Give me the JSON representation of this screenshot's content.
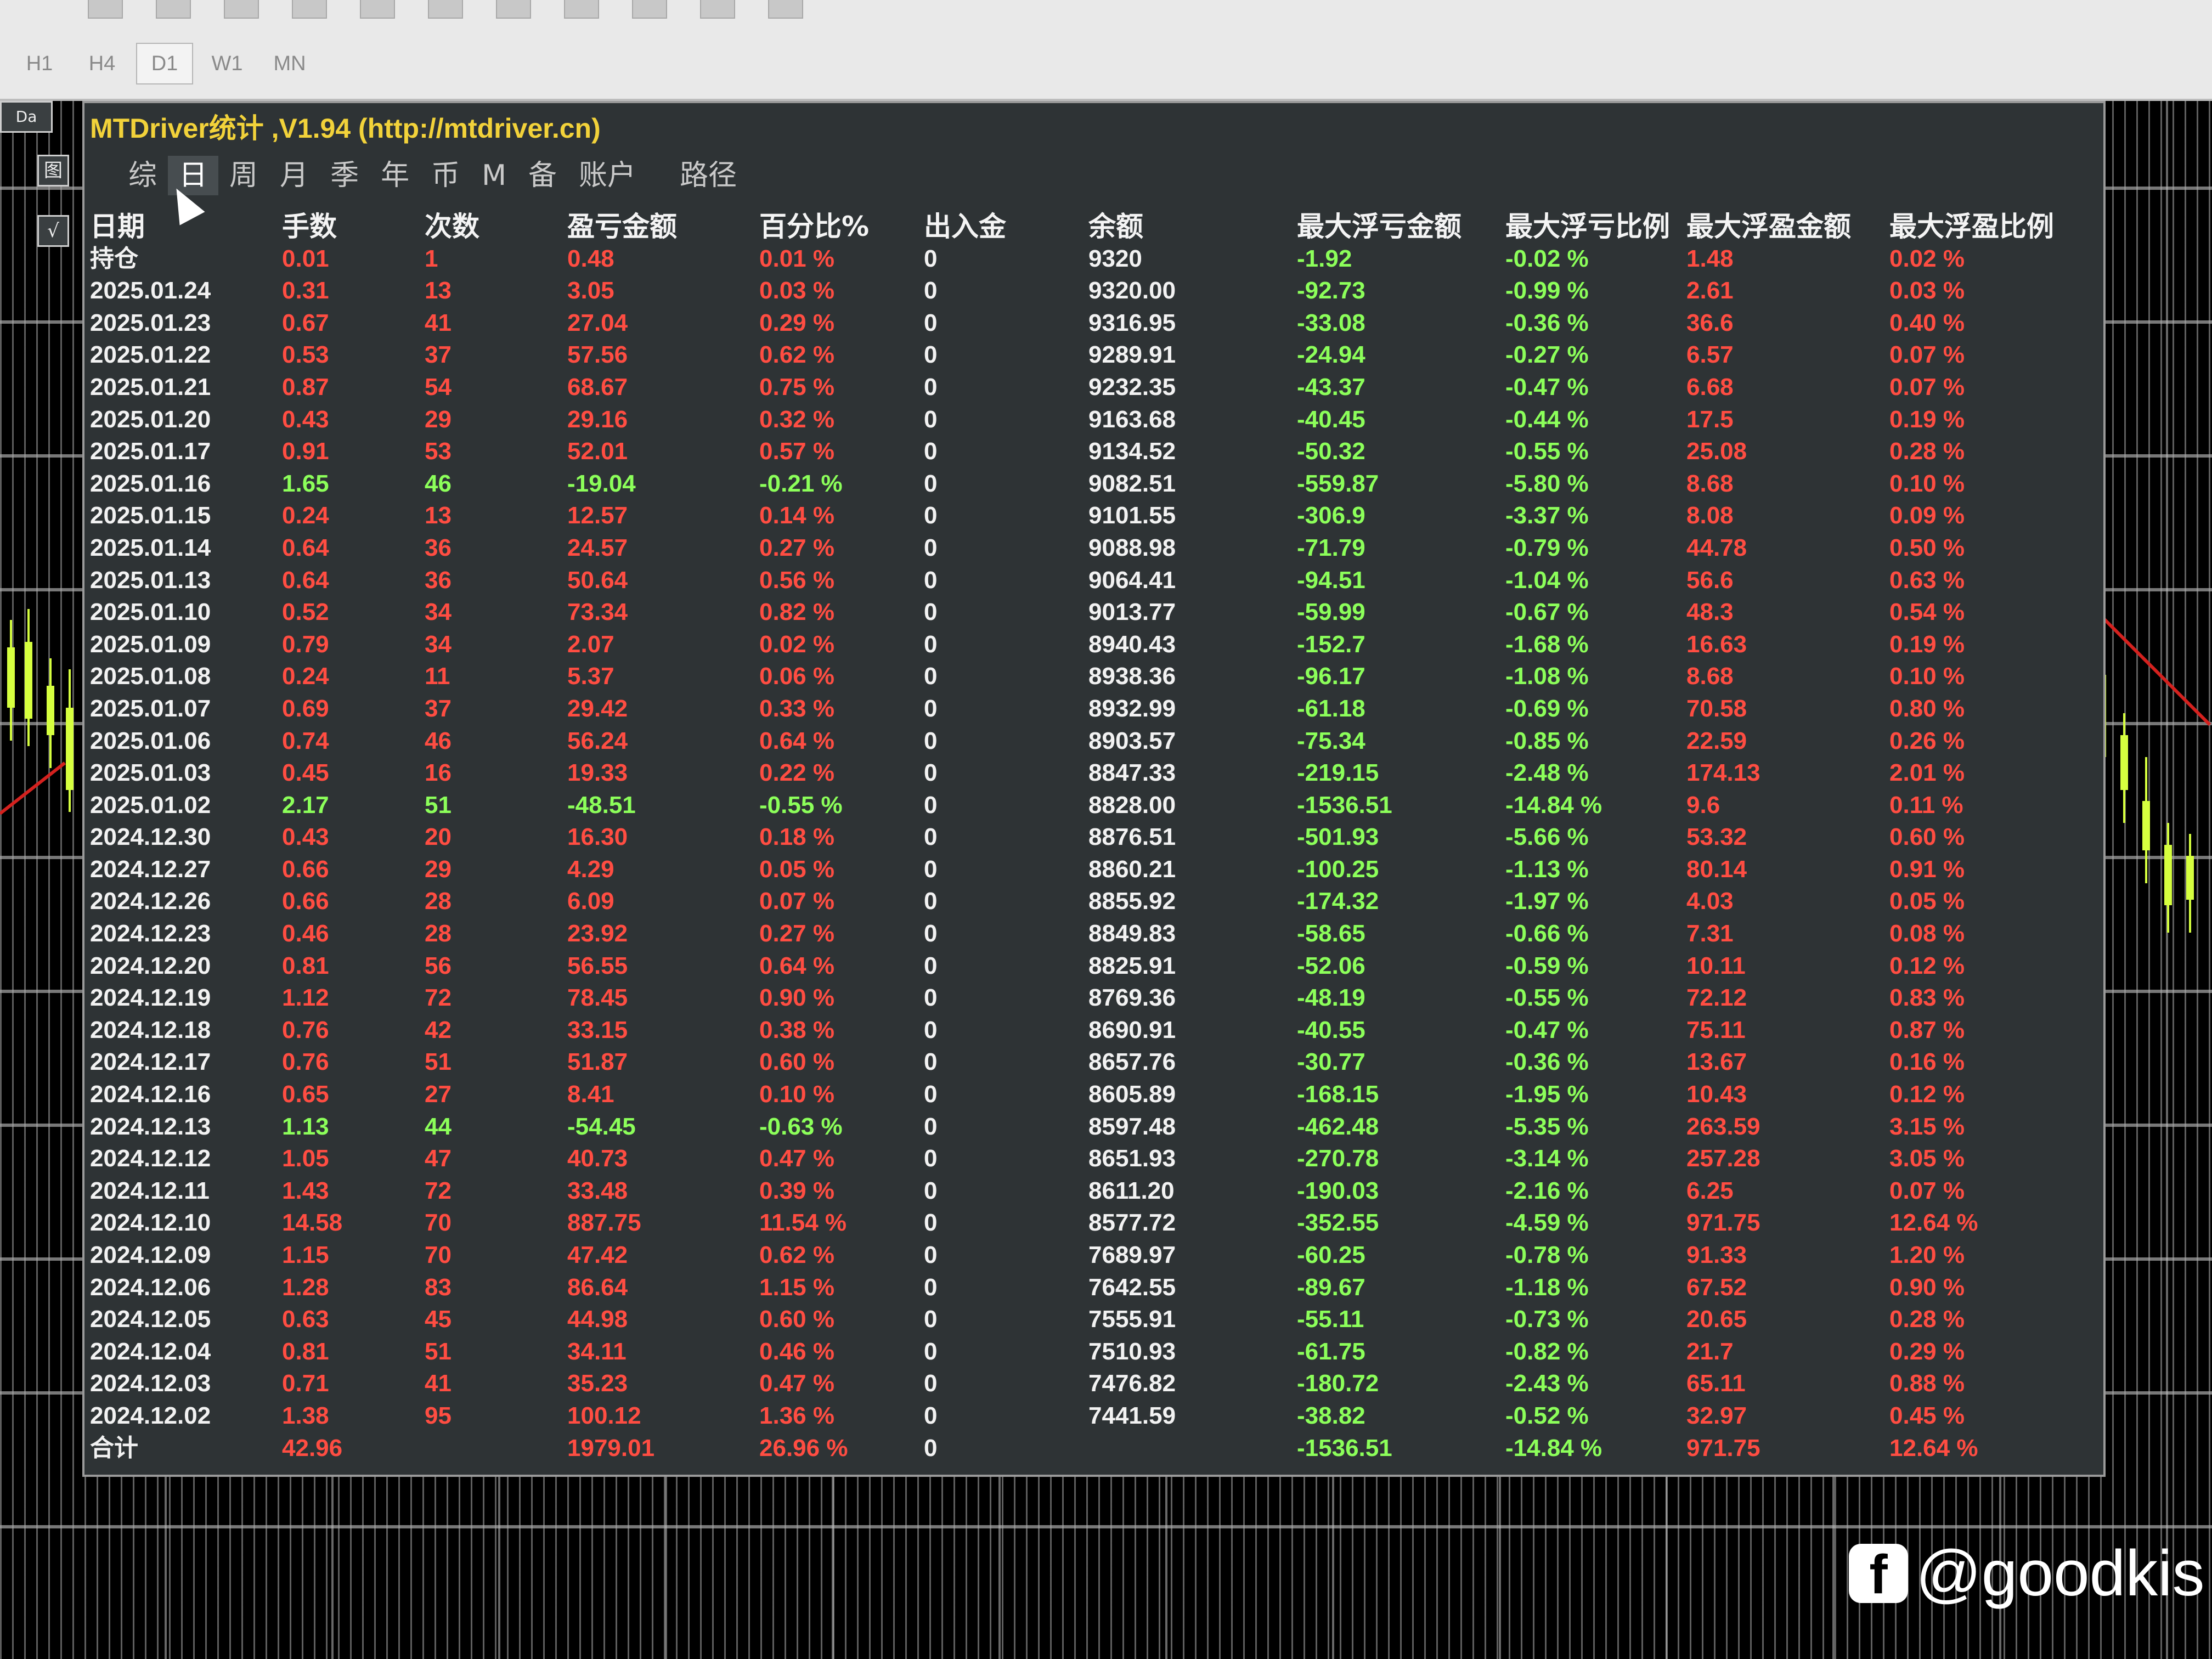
{
  "toolbar": {
    "timeframes": [
      "H1",
      "H4",
      "D1",
      "W1",
      "MN"
    ],
    "active_timeframe": "D1"
  },
  "window": {
    "title": "MTDriver统计 ,V1.94 (http://mtdriver.cn)",
    "corner_label": "Da",
    "side_buttons": [
      "图",
      "√"
    ]
  },
  "tabs": [
    {
      "label": "综"
    },
    {
      "label": "日",
      "active": true
    },
    {
      "label": "周"
    },
    {
      "label": "月"
    },
    {
      "label": "季"
    },
    {
      "label": "年"
    },
    {
      "label": "币"
    },
    {
      "label": "M"
    },
    {
      "label": "备"
    },
    {
      "label": "账户"
    },
    {
      "label": "路径"
    }
  ],
  "columns": [
    "日期",
    "手数",
    "次数",
    "盈亏金额",
    "百分比%",
    "出入金",
    "余额",
    "最大浮亏金额",
    "最大浮亏比例",
    "最大浮盈金额",
    "最大浮盈比例"
  ],
  "rows": [
    {
      "date": "持仓",
      "lots": "0.01",
      "count": "1",
      "pl": "0.48",
      "pct": "0.01 %",
      "io": "0",
      "balance": "9320",
      "max_float_loss": "-1.92",
      "max_float_loss_pct": "-0.02 %",
      "max_float_profit": "1.48",
      "max_float_profit_pct": "0.02 %",
      "tone": "r"
    },
    {
      "date": "2025.01.24",
      "lots": "0.31",
      "count": "13",
      "pl": "3.05",
      "pct": "0.03 %",
      "io": "0",
      "balance": "9320.00",
      "max_float_loss": "-92.73",
      "max_float_loss_pct": "-0.99 %",
      "max_float_profit": "2.61",
      "max_float_profit_pct": "0.03 %",
      "tone": "r"
    },
    {
      "date": "2025.01.23",
      "lots": "0.67",
      "count": "41",
      "pl": "27.04",
      "pct": "0.29 %",
      "io": "0",
      "balance": "9316.95",
      "max_float_loss": "-33.08",
      "max_float_loss_pct": "-0.36 %",
      "max_float_profit": "36.6",
      "max_float_profit_pct": "0.40 %",
      "tone": "r"
    },
    {
      "date": "2025.01.22",
      "lots": "0.53",
      "count": "37",
      "pl": "57.56",
      "pct": "0.62 %",
      "io": "0",
      "balance": "9289.91",
      "max_float_loss": "-24.94",
      "max_float_loss_pct": "-0.27 %",
      "max_float_profit": "6.57",
      "max_float_profit_pct": "0.07 %",
      "tone": "r"
    },
    {
      "date": "2025.01.21",
      "lots": "0.87",
      "count": "54",
      "pl": "68.67",
      "pct": "0.75 %",
      "io": "0",
      "balance": "9232.35",
      "max_float_loss": "-43.37",
      "max_float_loss_pct": "-0.47 %",
      "max_float_profit": "6.68",
      "max_float_profit_pct": "0.07 %",
      "tone": "r"
    },
    {
      "date": "2025.01.20",
      "lots": "0.43",
      "count": "29",
      "pl": "29.16",
      "pct": "0.32 %",
      "io": "0",
      "balance": "9163.68",
      "max_float_loss": "-40.45",
      "max_float_loss_pct": "-0.44 %",
      "max_float_profit": "17.5",
      "max_float_profit_pct": "0.19 %",
      "tone": "r"
    },
    {
      "date": "2025.01.17",
      "lots": "0.91",
      "count": "53",
      "pl": "52.01",
      "pct": "0.57 %",
      "io": "0",
      "balance": "9134.52",
      "max_float_loss": "-50.32",
      "max_float_loss_pct": "-0.55 %",
      "max_float_profit": "25.08",
      "max_float_profit_pct": "0.28 %",
      "tone": "r"
    },
    {
      "date": "2025.01.16",
      "lots": "1.65",
      "count": "46",
      "pl": "-19.04",
      "pct": "-0.21 %",
      "io": "0",
      "balance": "9082.51",
      "max_float_loss": "-559.87",
      "max_float_loss_pct": "-5.80 %",
      "max_float_profit": "8.68",
      "max_float_profit_pct": "0.10 %",
      "tone": "g"
    },
    {
      "date": "2025.01.15",
      "lots": "0.24",
      "count": "13",
      "pl": "12.57",
      "pct": "0.14 %",
      "io": "0",
      "balance": "9101.55",
      "max_float_loss": "-306.9",
      "max_float_loss_pct": "-3.37 %",
      "max_float_profit": "8.08",
      "max_float_profit_pct": "0.09 %",
      "tone": "r"
    },
    {
      "date": "2025.01.14",
      "lots": "0.64",
      "count": "36",
      "pl": "24.57",
      "pct": "0.27 %",
      "io": "0",
      "balance": "9088.98",
      "max_float_loss": "-71.79",
      "max_float_loss_pct": "-0.79 %",
      "max_float_profit": "44.78",
      "max_float_profit_pct": "0.50 %",
      "tone": "r"
    },
    {
      "date": "2025.01.13",
      "lots": "0.64",
      "count": "36",
      "pl": "50.64",
      "pct": "0.56 %",
      "io": "0",
      "balance": "9064.41",
      "max_float_loss": "-94.51",
      "max_float_loss_pct": "-1.04 %",
      "max_float_profit": "56.6",
      "max_float_profit_pct": "0.63 %",
      "tone": "r"
    },
    {
      "date": "2025.01.10",
      "lots": "0.52",
      "count": "34",
      "pl": "73.34",
      "pct": "0.82 %",
      "io": "0",
      "balance": "9013.77",
      "max_float_loss": "-59.99",
      "max_float_loss_pct": "-0.67 %",
      "max_float_profit": "48.3",
      "max_float_profit_pct": "0.54 %",
      "tone": "r"
    },
    {
      "date": "2025.01.09",
      "lots": "0.79",
      "count": "34",
      "pl": "2.07",
      "pct": "0.02 %",
      "io": "0",
      "balance": "8940.43",
      "max_float_loss": "-152.7",
      "max_float_loss_pct": "-1.68 %",
      "max_float_profit": "16.63",
      "max_float_profit_pct": "0.19 %",
      "tone": "r"
    },
    {
      "date": "2025.01.08",
      "lots": "0.24",
      "count": "11",
      "pl": "5.37",
      "pct": "0.06 %",
      "io": "0",
      "balance": "8938.36",
      "max_float_loss": "-96.17",
      "max_float_loss_pct": "-1.08 %",
      "max_float_profit": "8.68",
      "max_float_profit_pct": "0.10 %",
      "tone": "r"
    },
    {
      "date": "2025.01.07",
      "lots": "0.69",
      "count": "37",
      "pl": "29.42",
      "pct": "0.33 %",
      "io": "0",
      "balance": "8932.99",
      "max_float_loss": "-61.18",
      "max_float_loss_pct": "-0.69 %",
      "max_float_profit": "70.58",
      "max_float_profit_pct": "0.80 %",
      "tone": "r"
    },
    {
      "date": "2025.01.06",
      "lots": "0.74",
      "count": "46",
      "pl": "56.24",
      "pct": "0.64 %",
      "io": "0",
      "balance": "8903.57",
      "max_float_loss": "-75.34",
      "max_float_loss_pct": "-0.85 %",
      "max_float_profit": "22.59",
      "max_float_profit_pct": "0.26 %",
      "tone": "r"
    },
    {
      "date": "2025.01.03",
      "lots": "0.45",
      "count": "16",
      "pl": "19.33",
      "pct": "0.22 %",
      "io": "0",
      "balance": "8847.33",
      "max_float_loss": "-219.15",
      "max_float_loss_pct": "-2.48 %",
      "max_float_profit": "174.13",
      "max_float_profit_pct": "2.01 %",
      "tone": "r"
    },
    {
      "date": "2025.01.02",
      "lots": "2.17",
      "count": "51",
      "pl": "-48.51",
      "pct": "-0.55 %",
      "io": "0",
      "balance": "8828.00",
      "max_float_loss": "-1536.51",
      "max_float_loss_pct": "-14.84 %",
      "max_float_profit": "9.6",
      "max_float_profit_pct": "0.11 %",
      "tone": "g"
    },
    {
      "date": "2024.12.30",
      "lots": "0.43",
      "count": "20",
      "pl": "16.30",
      "pct": "0.18 %",
      "io": "0",
      "balance": "8876.51",
      "max_float_loss": "-501.93",
      "max_float_loss_pct": "-5.66 %",
      "max_float_profit": "53.32",
      "max_float_profit_pct": "0.60 %",
      "tone": "r"
    },
    {
      "date": "2024.12.27",
      "lots": "0.66",
      "count": "29",
      "pl": "4.29",
      "pct": "0.05 %",
      "io": "0",
      "balance": "8860.21",
      "max_float_loss": "-100.25",
      "max_float_loss_pct": "-1.13 %",
      "max_float_profit": "80.14",
      "max_float_profit_pct": "0.91 %",
      "tone": "r"
    },
    {
      "date": "2024.12.26",
      "lots": "0.66",
      "count": "28",
      "pl": "6.09",
      "pct": "0.07 %",
      "io": "0",
      "balance": "8855.92",
      "max_float_loss": "-174.32",
      "max_float_loss_pct": "-1.97 %",
      "max_float_profit": "4.03",
      "max_float_profit_pct": "0.05 %",
      "tone": "r"
    },
    {
      "date": "2024.12.23",
      "lots": "0.46",
      "count": "28",
      "pl": "23.92",
      "pct": "0.27 %",
      "io": "0",
      "balance": "8849.83",
      "max_float_loss": "-58.65",
      "max_float_loss_pct": "-0.66 %",
      "max_float_profit": "7.31",
      "max_float_profit_pct": "0.08 %",
      "tone": "r"
    },
    {
      "date": "2024.12.20",
      "lots": "0.81",
      "count": "56",
      "pl": "56.55",
      "pct": "0.64 %",
      "io": "0",
      "balance": "8825.91",
      "max_float_loss": "-52.06",
      "max_float_loss_pct": "-0.59 %",
      "max_float_profit": "10.11",
      "max_float_profit_pct": "0.12 %",
      "tone": "r"
    },
    {
      "date": "2024.12.19",
      "lots": "1.12",
      "count": "72",
      "pl": "78.45",
      "pct": "0.90 %",
      "io": "0",
      "balance": "8769.36",
      "max_float_loss": "-48.19",
      "max_float_loss_pct": "-0.55 %",
      "max_float_profit": "72.12",
      "max_float_profit_pct": "0.83 %",
      "tone": "r"
    },
    {
      "date": "2024.12.18",
      "lots": "0.76",
      "count": "42",
      "pl": "33.15",
      "pct": "0.38 %",
      "io": "0",
      "balance": "8690.91",
      "max_float_loss": "-40.55",
      "max_float_loss_pct": "-0.47 %",
      "max_float_profit": "75.11",
      "max_float_profit_pct": "0.87 %",
      "tone": "r"
    },
    {
      "date": "2024.12.17",
      "lots": "0.76",
      "count": "51",
      "pl": "51.87",
      "pct": "0.60 %",
      "io": "0",
      "balance": "8657.76",
      "max_float_loss": "-30.77",
      "max_float_loss_pct": "-0.36 %",
      "max_float_profit": "13.67",
      "max_float_profit_pct": "0.16 %",
      "tone": "r"
    },
    {
      "date": "2024.12.16",
      "lots": "0.65",
      "count": "27",
      "pl": "8.41",
      "pct": "0.10 %",
      "io": "0",
      "balance": "8605.89",
      "max_float_loss": "-168.15",
      "max_float_loss_pct": "-1.95 %",
      "max_float_profit": "10.43",
      "max_float_profit_pct": "0.12 %",
      "tone": "r"
    },
    {
      "date": "2024.12.13",
      "lots": "1.13",
      "count": "44",
      "pl": "-54.45",
      "pct": "-0.63 %",
      "io": "0",
      "balance": "8597.48",
      "max_float_loss": "-462.48",
      "max_float_loss_pct": "-5.35 %",
      "max_float_profit": "263.59",
      "max_float_profit_pct": "3.15 %",
      "tone": "g"
    },
    {
      "date": "2024.12.12",
      "lots": "1.05",
      "count": "47",
      "pl": "40.73",
      "pct": "0.47 %",
      "io": "0",
      "balance": "8651.93",
      "max_float_loss": "-270.78",
      "max_float_loss_pct": "-3.14 %",
      "max_float_profit": "257.28",
      "max_float_profit_pct": "3.05 %",
      "tone": "r"
    },
    {
      "date": "2024.12.11",
      "lots": "1.43",
      "count": "72",
      "pl": "33.48",
      "pct": "0.39 %",
      "io": "0",
      "balance": "8611.20",
      "max_float_loss": "-190.03",
      "max_float_loss_pct": "-2.16 %",
      "max_float_profit": "6.25",
      "max_float_profit_pct": "0.07 %",
      "tone": "r"
    },
    {
      "date": "2024.12.10",
      "lots": "14.58",
      "count": "70",
      "pl": "887.75",
      "pct": "11.54 %",
      "io": "0",
      "balance": "8577.72",
      "max_float_loss": "-352.55",
      "max_float_loss_pct": "-4.59 %",
      "max_float_profit": "971.75",
      "max_float_profit_pct": "12.64 %",
      "tone": "r"
    },
    {
      "date": "2024.12.09",
      "lots": "1.15",
      "count": "70",
      "pl": "47.42",
      "pct": "0.62 %",
      "io": "0",
      "balance": "7689.97",
      "max_float_loss": "-60.25",
      "max_float_loss_pct": "-0.78 %",
      "max_float_profit": "91.33",
      "max_float_profit_pct": "1.20 %",
      "tone": "r"
    },
    {
      "date": "2024.12.06",
      "lots": "1.28",
      "count": "83",
      "pl": "86.64",
      "pct": "1.15 %",
      "io": "0",
      "balance": "7642.55",
      "max_float_loss": "-89.67",
      "max_float_loss_pct": "-1.18 %",
      "max_float_profit": "67.52",
      "max_float_profit_pct": "0.90 %",
      "tone": "r"
    },
    {
      "date": "2024.12.05",
      "lots": "0.63",
      "count": "45",
      "pl": "44.98",
      "pct": "0.60 %",
      "io": "0",
      "balance": "7555.91",
      "max_float_loss": "-55.11",
      "max_float_loss_pct": "-0.73 %",
      "max_float_profit": "20.65",
      "max_float_profit_pct": "0.28 %",
      "tone": "r"
    },
    {
      "date": "2024.12.04",
      "lots": "0.81",
      "count": "51",
      "pl": "34.11",
      "pct": "0.46 %",
      "io": "0",
      "balance": "7510.93",
      "max_float_loss": "-61.75",
      "max_float_loss_pct": "-0.82 %",
      "max_float_profit": "21.7",
      "max_float_profit_pct": "0.29 %",
      "tone": "r"
    },
    {
      "date": "2024.12.03",
      "lots": "0.71",
      "count": "41",
      "pl": "35.23",
      "pct": "0.47 %",
      "io": "0",
      "balance": "7476.82",
      "max_float_loss": "-180.72",
      "max_float_loss_pct": "-2.43 %",
      "max_float_profit": "65.11",
      "max_float_profit_pct": "0.88 %",
      "tone": "r"
    },
    {
      "date": "2024.12.02",
      "lots": "1.38",
      "count": "95",
      "pl": "100.12",
      "pct": "1.36 %",
      "io": "0",
      "balance": "7441.59",
      "max_float_loss": "-38.82",
      "max_float_loss_pct": "-0.52 %",
      "max_float_profit": "32.97",
      "max_float_profit_pct": "0.45 %",
      "tone": "r"
    }
  ],
  "total": {
    "label": "合计",
    "lots": "42.96",
    "count": "",
    "pl": "1979.01",
    "pct": "26.96 %",
    "io": "0",
    "balance": "",
    "max_float_loss": "-1536.51",
    "max_float_loss_pct": "-14.84 %",
    "max_float_profit": "971.75",
    "max_float_profit_pct": "12.64 %"
  },
  "watermark": {
    "logo_icon": "facebook-logo-icon",
    "text": "@goodkis"
  },
  "colors": {
    "profit": "#ff4d42",
    "loss": "#8cff5a",
    "title": "#f2d23a",
    "panel_bg": "#2e3335"
  }
}
